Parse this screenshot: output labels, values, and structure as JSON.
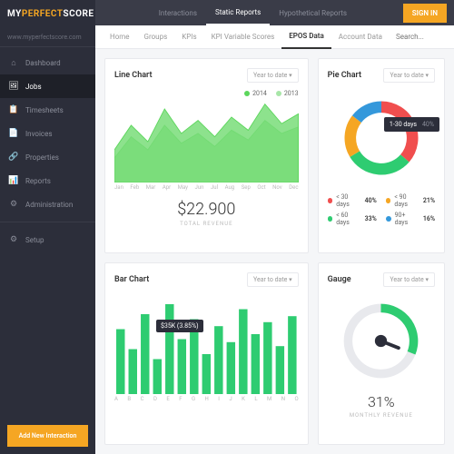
{
  "brand": {
    "prefix": "MY",
    "accent": "PERFECT",
    "suffix": "SCORE"
  },
  "url": "www.myperfectscore.com",
  "sidebar": {
    "items": [
      {
        "label": "Dashboard",
        "icon": "⌂"
      },
      {
        "label": "Jobs",
        "icon": "🖼"
      },
      {
        "label": "Timesheets",
        "icon": "📋"
      },
      {
        "label": "Invoices",
        "icon": "📄"
      },
      {
        "label": "Properties",
        "icon": "🔗"
      },
      {
        "label": "Reports",
        "icon": "📊"
      },
      {
        "label": "Administration",
        "icon": "⚙"
      },
      {
        "label": "Setup",
        "icon": "⚙"
      }
    ],
    "add_btn": "Add New Interaction"
  },
  "topnav": {
    "tabs": [
      "Interactions",
      "Static Reports",
      "Hypothetical Reports"
    ],
    "signin": "SIGN IN"
  },
  "subnav": {
    "tabs": [
      "Home",
      "Groups",
      "KPIs",
      "KPI Variable Scores",
      "EPOS Data",
      "Account Data"
    ],
    "search_placeholder": "Search..."
  },
  "cards": {
    "line": {
      "title": "Line Chart",
      "dropdown": "Year to date ▾"
    },
    "pie": {
      "title": "Pie Chart",
      "dropdown": "Year to date ▾"
    },
    "bar": {
      "title": "Bar Chart",
      "dropdown": "Year to date ▾"
    },
    "gauge": {
      "title": "Gauge",
      "dropdown": "Year to date ▾"
    }
  },
  "revenue": {
    "amount": "$22.900",
    "label": "TOTAL REVENUE"
  },
  "pie_tooltip": {
    "label": "1-30 days",
    "pct": "40%"
  },
  "pie_legend": [
    {
      "label": "< 30 days",
      "val": "40%",
      "color": "#f04e4e"
    },
    {
      "label": "< 90 days",
      "val": "21%",
      "color": "#f5a623"
    },
    {
      "label": "< 60 days",
      "val": "33%",
      "color": "#2ecc71"
    },
    {
      "label": "90+ days",
      "val": "16%",
      "color": "#3498db"
    }
  ],
  "bar_tooltip": "$35K (3.85%)",
  "gauge": {
    "pct": "31%",
    "label": "MONTHLY REVENUE"
  },
  "chart_data": {
    "line": {
      "type": "area",
      "categories": [
        "Jan",
        "Feb",
        "Mar",
        "Apr",
        "May",
        "Jun",
        "Jul",
        "Aug",
        "Sep",
        "Oct",
        "Nov",
        "Dec"
      ],
      "series": [
        {
          "name": "2014",
          "values": [
            20,
            35,
            25,
            45,
            30,
            38,
            28,
            40,
            32,
            48,
            36,
            42
          ],
          "color": "#5cd65c"
        },
        {
          "name": "2013",
          "values": [
            15,
            28,
            20,
            35,
            24,
            30,
            22,
            32,
            26,
            38,
            30,
            34
          ],
          "color": "#a8e6a8"
        }
      ],
      "ylim": [
        0,
        50
      ]
    },
    "pie": {
      "type": "pie",
      "slices": [
        {
          "label": "< 30 days",
          "value": 40,
          "color": "#f04e4e"
        },
        {
          "label": "< 60 days",
          "value": 33,
          "color": "#2ecc71"
        },
        {
          "label": "< 90 days",
          "value": 21,
          "color": "#f5a623"
        },
        {
          "label": "90+ days",
          "value": 16,
          "color": "#3498db"
        }
      ]
    },
    "bar": {
      "type": "bar",
      "categories": [
        "A",
        "B",
        "C",
        "D",
        "E",
        "F",
        "G",
        "H",
        "I",
        "J",
        "K",
        "L",
        "M",
        "N",
        "O"
      ],
      "values": [
        65,
        45,
        80,
        35,
        90,
        55,
        75,
        40,
        68,
        52,
        85,
        60,
        72,
        48,
        78
      ],
      "ylim": [
        0,
        100
      ],
      "color": "#2ecc71"
    },
    "gauge": {
      "type": "gauge",
      "value": 31,
      "max": 100
    }
  }
}
